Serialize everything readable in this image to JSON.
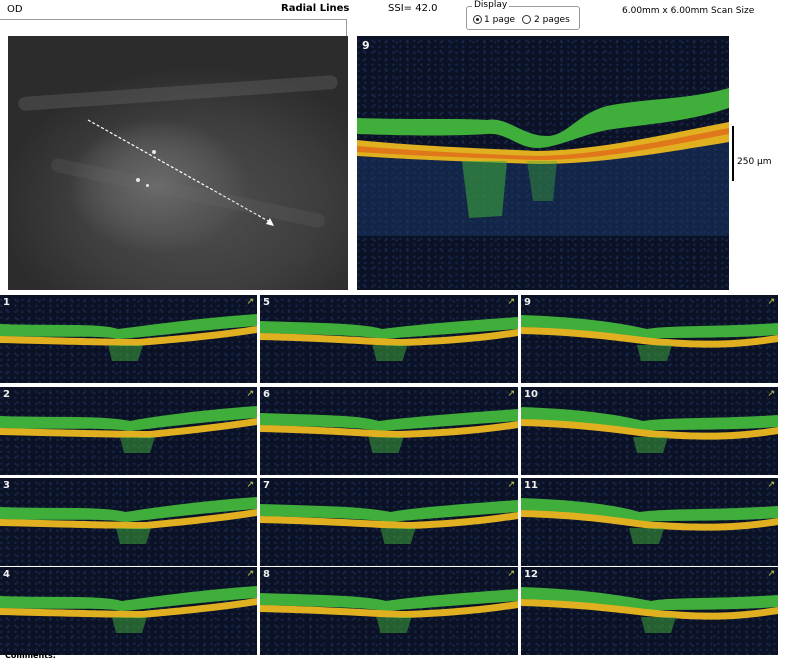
{
  "header": {
    "eye": "OD",
    "scan_type": "Radial Lines",
    "ssi": "SSI= 42.0",
    "display_label": "Display",
    "display_options": [
      "1 page",
      "2 pages"
    ],
    "scan_size": "6.00mm x 6.00mm Scan Size"
  },
  "main_scan": {
    "number": "9",
    "scale_label": "250 µm"
  },
  "thumbnails": [
    {
      "label": "1"
    },
    {
      "label": "5"
    },
    {
      "label": "9"
    },
    {
      "label": "2"
    },
    {
      "label": "6"
    },
    {
      "label": "10"
    },
    {
      "label": "3"
    },
    {
      "label": "7"
    },
    {
      "label": "11"
    },
    {
      "label": "4"
    },
    {
      "label": "8"
    },
    {
      "label": "12"
    }
  ],
  "footer": {
    "comments_label": "Comments:"
  },
  "colors": {
    "rnfl": "#3fae3a",
    "rpe": "#e0b020",
    "rpe_core": "#e06018",
    "background": "#0c1226",
    "arrow": "#d4d64a"
  }
}
